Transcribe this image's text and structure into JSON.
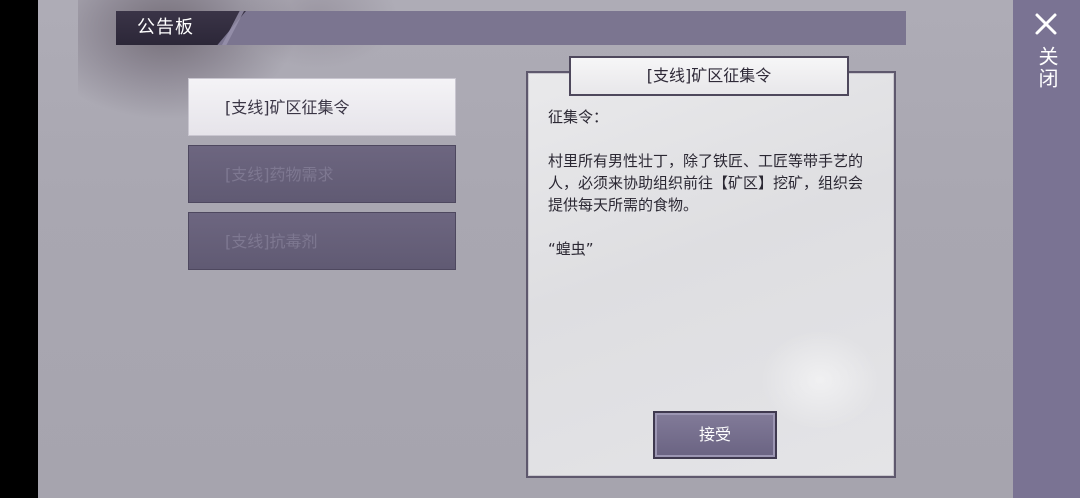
{
  "header": {
    "title": "公告板"
  },
  "close": {
    "label": "关闭"
  },
  "quests": [
    {
      "label": "[支线]矿区征集令",
      "selected": true
    },
    {
      "label": "[支线]药物需求",
      "selected": false
    },
    {
      "label": "[支线]抗毒剂",
      "selected": false
    }
  ],
  "notice": {
    "title": "[支线]矿区征集令",
    "heading": "征集令：",
    "body": "村里所有男性壮丁，除了铁匠、工匠等带手艺的人，必须来协助组织前往【矿区】挖矿，组织会提供每天所需的食物。",
    "signature": "“蝗虫”"
  },
  "accept": {
    "label": "接受"
  },
  "icons": {
    "close": "close-icon"
  },
  "colors": {
    "panel": "#7b7590",
    "accent_dark": "#2c2738",
    "paper": "#e6e6e9"
  }
}
